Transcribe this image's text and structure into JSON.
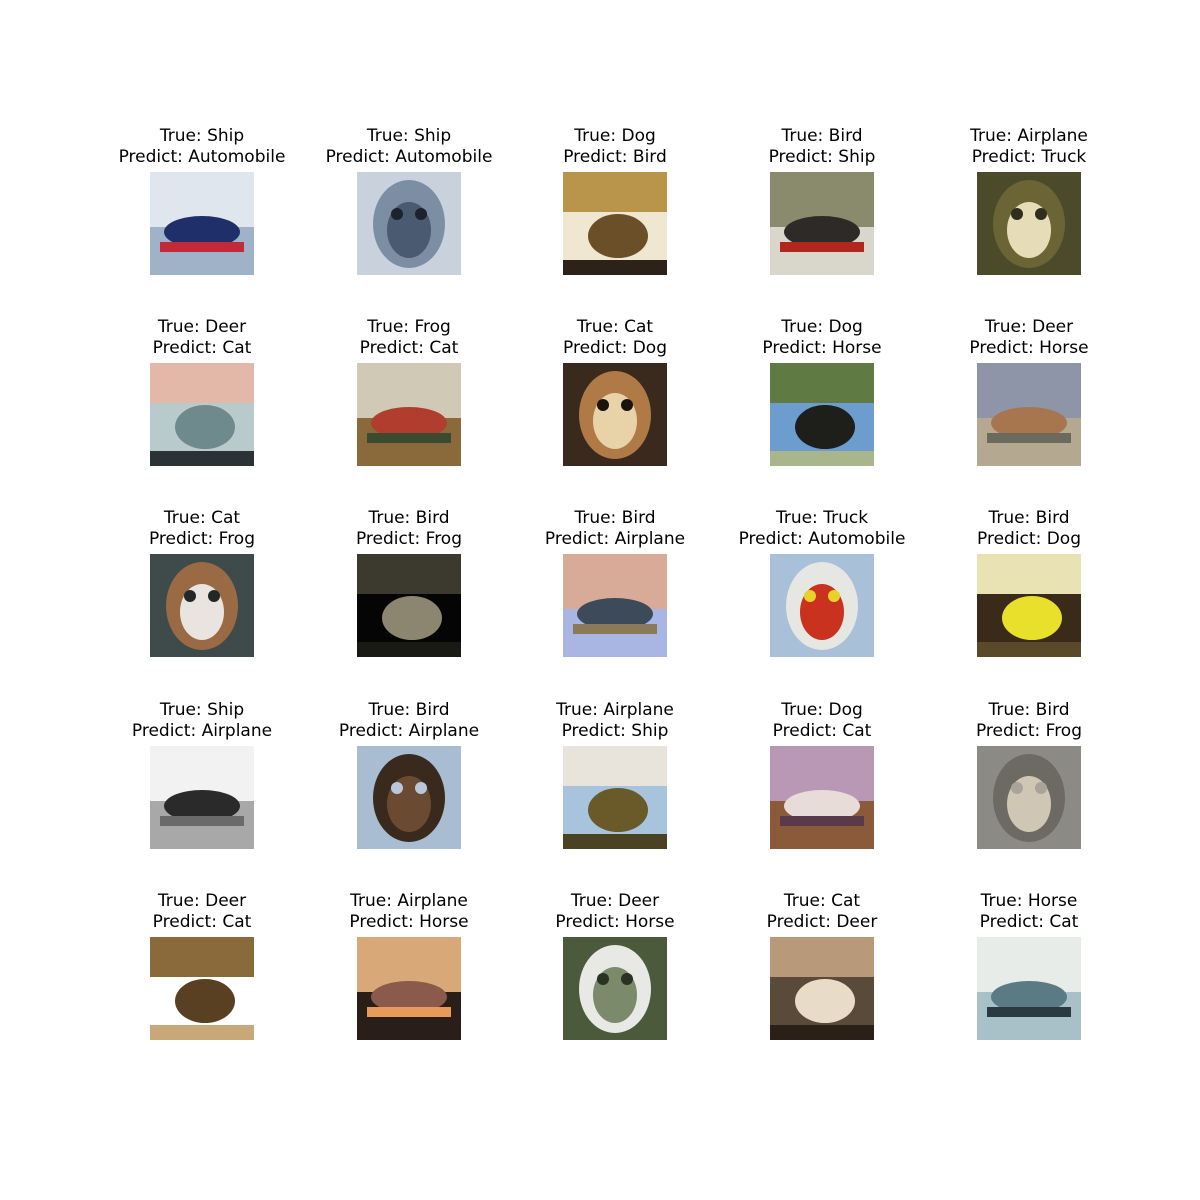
{
  "grid": {
    "cells": [
      {
        "true_label": "True: Ship",
        "predict_label": "Predict: Automobile",
        "image": "ship-photo",
        "tones": [
          "#dfe6ee",
          "#9fb2c8",
          "#1f2f6a",
          "#c22a3a"
        ]
      },
      {
        "true_label": "True: Ship",
        "predict_label": "Predict: Automobile",
        "image": "ship-photo",
        "tones": [
          "#c8d1dc",
          "#7c8ea4",
          "#4a5a70",
          "#1c232c"
        ]
      },
      {
        "true_label": "True: Dog",
        "predict_label": "Predict: Bird",
        "image": "dog-photo",
        "tones": [
          "#efe7cf",
          "#b8954a",
          "#6a4f28",
          "#2c2218"
        ]
      },
      {
        "true_label": "True: Bird",
        "predict_label": "Predict: Ship",
        "image": "bird-photo",
        "tones": [
          "#8a8a6c",
          "#d9d6cc",
          "#2e2a28",
          "#b3261e"
        ]
      },
      {
        "true_label": "True: Airplane",
        "predict_label": "Predict: Truck",
        "image": "airplane-photo",
        "tones": [
          "#4b4a2a",
          "#6b6434",
          "#e7dcb8",
          "#2f2d1c"
        ]
      },
      {
        "true_label": "True: Deer",
        "predict_label": "Predict: Cat",
        "image": "deer-photo",
        "tones": [
          "#b9cacc",
          "#e3b8a8",
          "#6f8a8c",
          "#2b3236"
        ]
      },
      {
        "true_label": "True: Frog",
        "predict_label": "Predict: Cat",
        "image": "frog-photo",
        "tones": [
          "#cfc9b6",
          "#8a6a3a",
          "#b13d2e",
          "#3c4a32"
        ]
      },
      {
        "true_label": "True: Cat",
        "predict_label": "Predict: Dog",
        "image": "cat-photo",
        "tones": [
          "#3a2a1e",
          "#b07a46",
          "#e8d2a8",
          "#1a140f"
        ]
      },
      {
        "true_label": "True: Dog",
        "predict_label": "Predict: Horse",
        "image": "dog-photo",
        "tones": [
          "#6d9ccf",
          "#5f7a42",
          "#1e1e1a",
          "#a9b58a"
        ]
      },
      {
        "true_label": "True: Deer",
        "predict_label": "Predict: Horse",
        "image": "deer-photo",
        "tones": [
          "#8e95a8",
          "#b4a890",
          "#a8764e",
          "#6a6a5e"
        ]
      },
      {
        "true_label": "True: Cat",
        "predict_label": "Predict: Frog",
        "image": "cat-photo",
        "tones": [
          "#3f4b4a",
          "#9a6a44",
          "#e9e4df",
          "#22282a"
        ]
      },
      {
        "true_label": "True: Bird",
        "predict_label": "Predict: Frog",
        "image": "bird-photo",
        "tones": [
          "#050505",
          "#3c3a2e",
          "#8c8670",
          "#1a1a14"
        ]
      },
      {
        "true_label": "True: Bird",
        "predict_label": "Predict: Airplane",
        "image": "bird-photo",
        "tones": [
          "#d8aa98",
          "#a9b6e4",
          "#3c4a5a",
          "#8a7a5a"
        ]
      },
      {
        "true_label": "True: Truck",
        "predict_label": "Predict: Automobile",
        "image": "truck-photo",
        "tones": [
          "#a8c0d8",
          "#e6e6e2",
          "#c8321e",
          "#e8d22a"
        ]
      },
      {
        "true_label": "True: Bird",
        "predict_label": "Predict: Dog",
        "image": "bird-photo",
        "tones": [
          "#3a2a1a",
          "#e9e2b2",
          "#e8e02a",
          "#5a4a2a"
        ]
      },
      {
        "true_label": "True: Ship",
        "predict_label": "Predict: Airplane",
        "image": "ship-photo",
        "tones": [
          "#f2f2f2",
          "#a8a8a8",
          "#2a2a2a",
          "#6a6a6a"
        ]
      },
      {
        "true_label": "True: Bird",
        "predict_label": "Predict: Airplane",
        "image": "bird-photo",
        "tones": [
          "#a8bcd2",
          "#3a2a1e",
          "#6a4a30",
          "#b8c8da"
        ]
      },
      {
        "true_label": "True: Airplane",
        "predict_label": "Predict: Ship",
        "image": "airplane-photo",
        "tones": [
          "#a8c4dc",
          "#e8e4dc",
          "#6a5a2a",
          "#4a4222"
        ]
      },
      {
        "true_label": "True: Dog",
        "predict_label": "Predict: Cat",
        "image": "dog-photo",
        "tones": [
          "#b898b4",
          "#8a5a3a",
          "#e8dcd8",
          "#5a3a4a"
        ]
      },
      {
        "true_label": "True: Bird",
        "predict_label": "Predict: Frog",
        "image": "bird-photo",
        "tones": [
          "#8c8a84",
          "#6c6a62",
          "#cfc6b4",
          "#a8a49a"
        ]
      },
      {
        "true_label": "True: Deer",
        "predict_label": "Predict: Cat",
        "image": "deer-photo",
        "tones": [
          "#ffffff",
          "#8a6a3a",
          "#5a4022",
          "#c8a878"
        ]
      },
      {
        "true_label": "True: Airplane",
        "predict_label": "Predict: Horse",
        "image": "airplane-photo",
        "tones": [
          "#d8a878",
          "#2a1e1a",
          "#8a5a4a",
          "#e89a5a"
        ]
      },
      {
        "true_label": "True: Deer",
        "predict_label": "Predict: Horse",
        "image": "deer-photo",
        "tones": [
          "#4a5a3a",
          "#e8e8e4",
          "#7a8a6a",
          "#2a3222"
        ]
      },
      {
        "true_label": "True: Cat",
        "predict_label": "Predict: Deer",
        "image": "cat-photo",
        "tones": [
          "#5a4a3a",
          "#b89a7a",
          "#e8dcc8",
          "#2a2018"
        ]
      },
      {
        "true_label": "True: Horse",
        "predict_label": "Predict: Cat",
        "image": "horse-photo",
        "tones": [
          "#e8ece8",
          "#a8c0c8",
          "#5a7a84",
          "#2a3a40"
        ]
      }
    ]
  }
}
